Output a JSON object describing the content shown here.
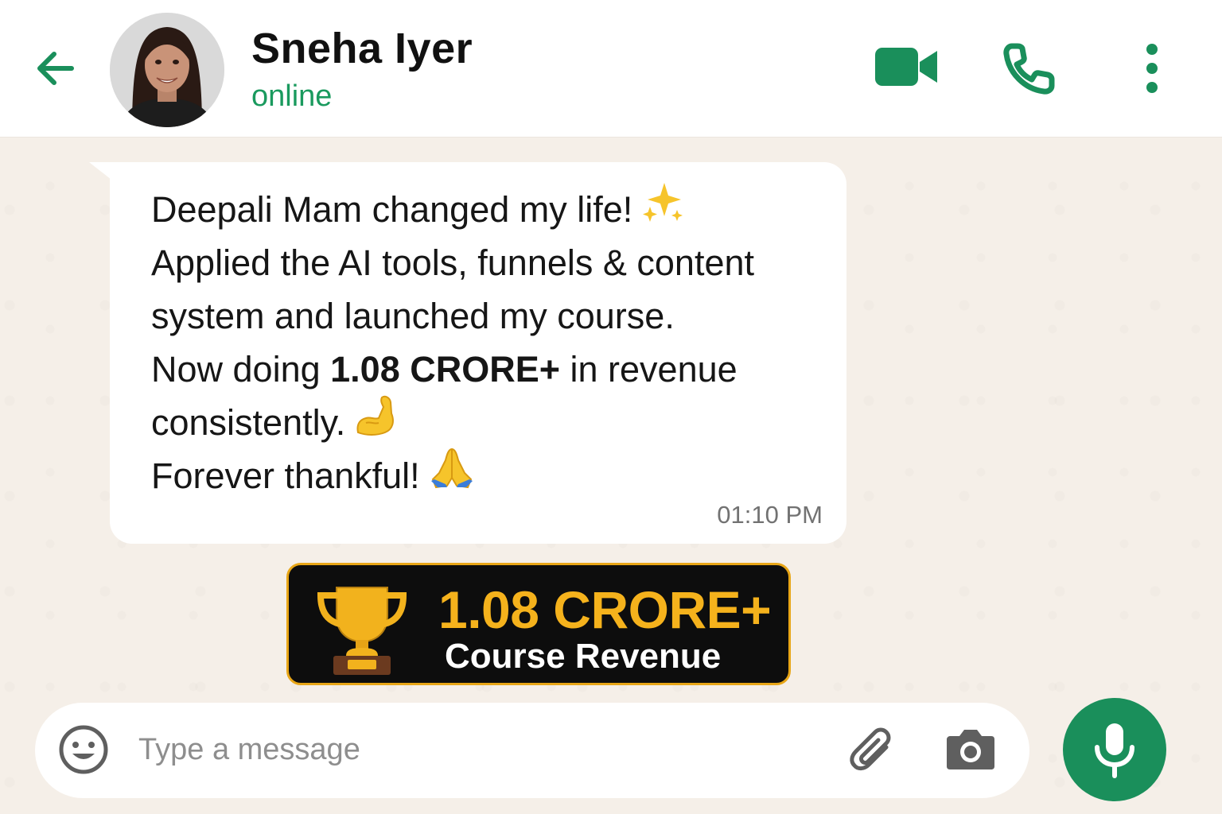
{
  "colors": {
    "accent": "#1a8f5b",
    "status": "#1a9a5e",
    "chat_background": "#f5efe8",
    "badge_background": "#0d0d0d",
    "badge_gold": "#f5b21c"
  },
  "header": {
    "back_icon": "arrow-left-icon",
    "contact_name": "Sneha Iyer",
    "status": "online",
    "actions": [
      "video-call-icon",
      "phone-icon",
      "more-vertical-icon"
    ]
  },
  "message": {
    "line1": "Deepali Mam changed my life!",
    "line1_emoji": "sparkles-icon",
    "line2": "Applied the AI tools, funnels & content",
    "line3": "system and launched my course.",
    "line4_pre": "Now doing ",
    "line4_bold": "1.08 CRORE+",
    "line4_post": " in revenue",
    "line5": "consistently.",
    "line5_emoji": "flexed-biceps-icon",
    "line6": "Forever thankful!",
    "line6_emoji": "folded-hands-icon",
    "time": "01:10 PM"
  },
  "badge": {
    "icon": "trophy-icon",
    "amount": "1.08 CRORE+",
    "label": "Course Revenue"
  },
  "composer": {
    "placeholder": "Type a message",
    "value": "",
    "icons": [
      "emoji-smiley-icon",
      "paperclip-icon",
      "camera-icon",
      "microphone-icon"
    ]
  }
}
